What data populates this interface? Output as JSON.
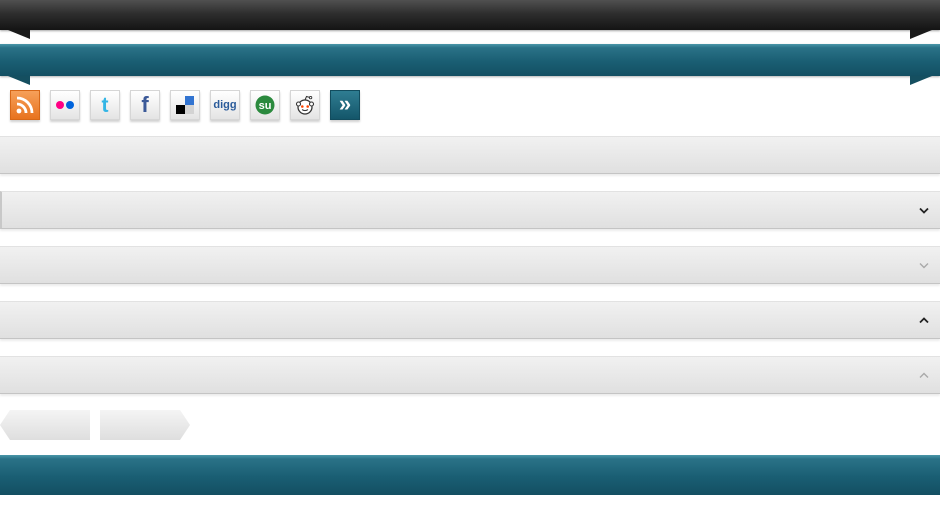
{
  "social_icons": [
    {
      "name": "rss-icon",
      "label": ""
    },
    {
      "name": "flickr-icon",
      "label": ""
    },
    {
      "name": "twitter-icon",
      "label": "t"
    },
    {
      "name": "facebook-icon",
      "label": "f"
    },
    {
      "name": "delicious-icon",
      "label": ""
    },
    {
      "name": "digg-icon",
      "label": "digg"
    },
    {
      "name": "stumbleupon-icon",
      "label": "su"
    },
    {
      "name": "reddit-icon",
      "label": ""
    },
    {
      "name": "more-icon",
      "label": "»"
    }
  ],
  "bars": [
    {
      "name": "plain-bar",
      "chevron": "none"
    },
    {
      "name": "dropdown-bar",
      "chevron": "down-dark"
    },
    {
      "name": "dropdown-bar",
      "chevron": "down-light"
    },
    {
      "name": "dropdown-bar",
      "chevron": "up-dark"
    },
    {
      "name": "dropdown-bar",
      "chevron": "up-light"
    }
  ],
  "colors": {
    "dark_ribbon": "#2e2e2e",
    "teal_ribbon": "#1a5e73",
    "rss_orange": "#e8731e",
    "flickr_pink": "#ff0084",
    "flickr_blue": "#0063dc",
    "twitter_blue": "#33b5e5",
    "facebook_blue": "#3b5998",
    "digg_blue": "#2a5b9a",
    "stumble_green": "#2b8a3e"
  }
}
